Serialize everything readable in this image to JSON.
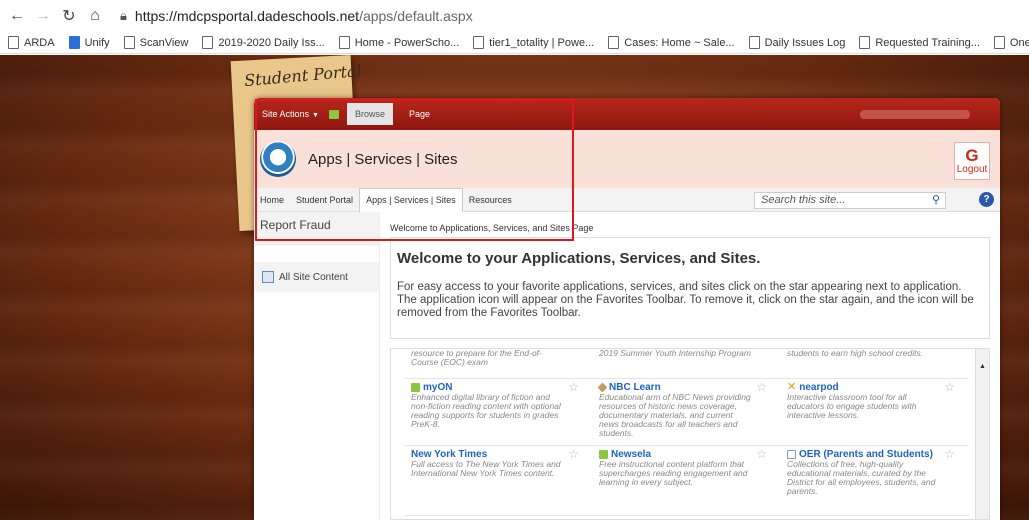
{
  "browser": {
    "url_domain": "https://mdcpsportal.dadeschools.net",
    "url_path": "/apps/default.aspx"
  },
  "bookmarks": [
    "ARDA",
    "Unify",
    "ScanView",
    "2019-2020 Daily Iss...",
    "Home - PowerScho...",
    "tier1_totality | Powe...",
    "Cases: Home ~ Sale...",
    "Daily Issues Log",
    "Requested Training...",
    "OneLook Diction"
  ],
  "sticky_title": "Student Portal",
  "ribbon": {
    "site_actions": "Site Actions",
    "browse": "Browse",
    "page": "Page"
  },
  "header": {
    "title": "Apps | Services | Sites",
    "logout": "Logout"
  },
  "topnav": [
    "Home",
    "Student Portal",
    "Apps | Services | Sites",
    "Resources"
  ],
  "search": {
    "placeholder": "Search this site..."
  },
  "leftnav": {
    "report_fraud": "Report Fraud",
    "all_content": "All Site Content"
  },
  "breadcrumb": "Welcome to Applications, Services, and Sites Page",
  "welcome": {
    "heading": "Welcome to your Applications, Services, and Sites.",
    "body": "For easy access to your favorite applications, services, and sites click on the star appearing next to application. The application icon will appear on the Favorites Toolbar.  To remove it, click on the star again, and the icon will be removed from the Favorites Toolbar."
  },
  "apps": {
    "top": [
      "resource to prepare for the End-of-Course (EOC) exam",
      "2019 Summer Youth Internship Program",
      "students to earn high school credits."
    ],
    "mid": [
      {
        "title": "myON",
        "desc": "Enhanced digital library of fiction and non-fiction reading content with optional reading supports for students in grades PreK-8."
      },
      {
        "title": "NBC Learn",
        "desc": "Educational arm of NBC News providing resources of historic news coverage, documentary materials, and current news broadcasts for all teachers and students."
      },
      {
        "title": "nearpod",
        "desc": "Interactive classroom tool for all educators to engage students with interactive lessons."
      }
    ],
    "bot": [
      {
        "title": "New York Times",
        "desc": "Full access to The New York Times and International New York Times content."
      },
      {
        "title": "Newsela",
        "desc": "Free instructional content platform that supercharges reading engagement and learning in every subject."
      },
      {
        "title": "OER (Parents and Students)",
        "desc": "Collections of free, high-quality educational materials, curated by the District for all employees, students, and parents."
      }
    ]
  },
  "colors": {
    "ribbon": "#b8271b",
    "annotation": "#e0161e",
    "link": "#1f62c0"
  }
}
